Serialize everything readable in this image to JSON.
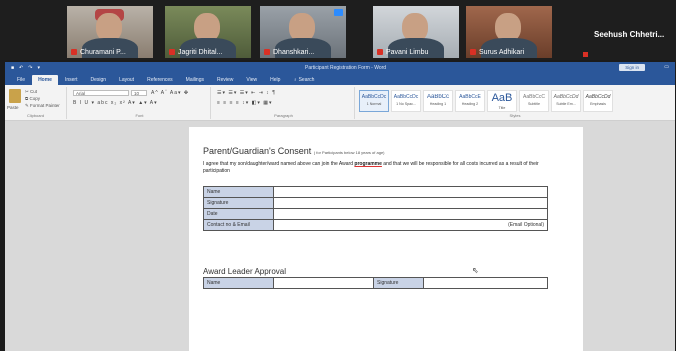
{
  "meeting": {
    "participants": [
      {
        "name": "Churamani P..."
      },
      {
        "name": "Jagriti Dhital..."
      },
      {
        "name": "Dhanshkari..."
      },
      {
        "name": "Pavani Limbu"
      },
      {
        "name": "Surus Adhikari"
      }
    ],
    "self_name": "Seehush Chhetri..."
  },
  "word": {
    "title": "Participant Registration Form - Word",
    "signin": "Sign in",
    "tabs": [
      "File",
      "Home",
      "Insert",
      "Design",
      "Layout",
      "References",
      "Mailings",
      "Review",
      "View",
      "Help",
      "Search"
    ],
    "active_tab": "Home",
    "clipboard": {
      "paste": "Paste",
      "cut": "Cut",
      "copy": "Copy",
      "format_painter": "Format Painter",
      "label": "Clipboard"
    },
    "font": {
      "name": "Arial",
      "size": "10",
      "label": "Font"
    },
    "paragraph_label": "Paragraph",
    "styles_label": "Styles",
    "styles": [
      {
        "sample": "AaBbCcDc",
        "name": "1 Normal"
      },
      {
        "sample": "AaBbCcDc",
        "name": "1 No Spac..."
      },
      {
        "sample": "AaBbCc",
        "name": "Heading 1"
      },
      {
        "sample": "AaBbCcE",
        "name": "Heading 2"
      },
      {
        "sample": "AaB",
        "name": "Title"
      },
      {
        "sample": "AaBbCcC",
        "name": "Subtitle"
      },
      {
        "sample": "AaBbCcDd",
        "name": "Subtle Em..."
      },
      {
        "sample": "AaBbCcDd",
        "name": "Emphasis"
      }
    ]
  },
  "doc": {
    "consent_heading": "Parent/Guardian's Consent",
    "consent_note": "( for Participants below 18 years of age)",
    "consent_text_1": "I agree that my son/daughter/ward named above can join the Award ",
    "consent_text_link": "programme",
    "consent_text_2": " and that we will be responsible for all costs incurred as a result of their participation",
    "consent_rows": [
      {
        "label": "Name",
        "value": ""
      },
      {
        "label": "Signature",
        "value": ""
      },
      {
        "label": "Date",
        "value": ""
      },
      {
        "label": "Contact no & Email",
        "value": "(Email Optional)"
      }
    ],
    "approval_heading": "Award Leader Approval",
    "approval_row": {
      "name_label": "Name",
      "signature_label": "Signature"
    }
  }
}
